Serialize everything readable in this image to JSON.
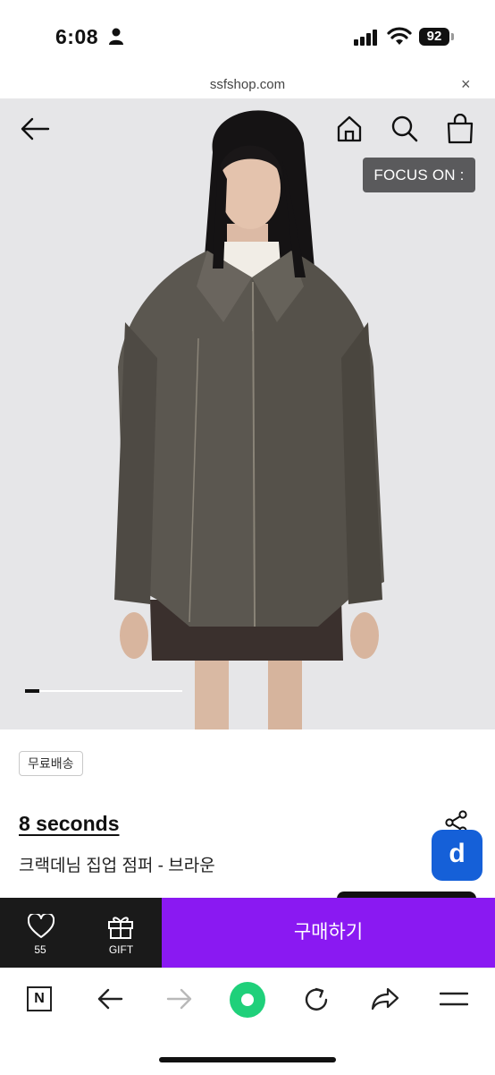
{
  "status_bar": {
    "time": "6:08",
    "battery": "92"
  },
  "url_bar": {
    "domain": "ssfshop.com",
    "close": "×"
  },
  "hero": {
    "focus_label": "FOCUS ON :",
    "gallery_progress": 0.09
  },
  "product": {
    "badge": "무료배송",
    "brand": "8 seconds",
    "name": "크랙데님 집업 점퍼 - 브라운",
    "share_icon": "share-icon"
  },
  "fab": {
    "label": "d"
  },
  "buy_bar": {
    "like_count": "55",
    "gift_label": "GIFT",
    "buy_label": "구매하기"
  },
  "toolbar": {
    "n_label": "N"
  },
  "colors": {
    "buy_button": "#8a19f2",
    "fab": "#1560d8",
    "toolbar_center": "#1fd07a"
  }
}
